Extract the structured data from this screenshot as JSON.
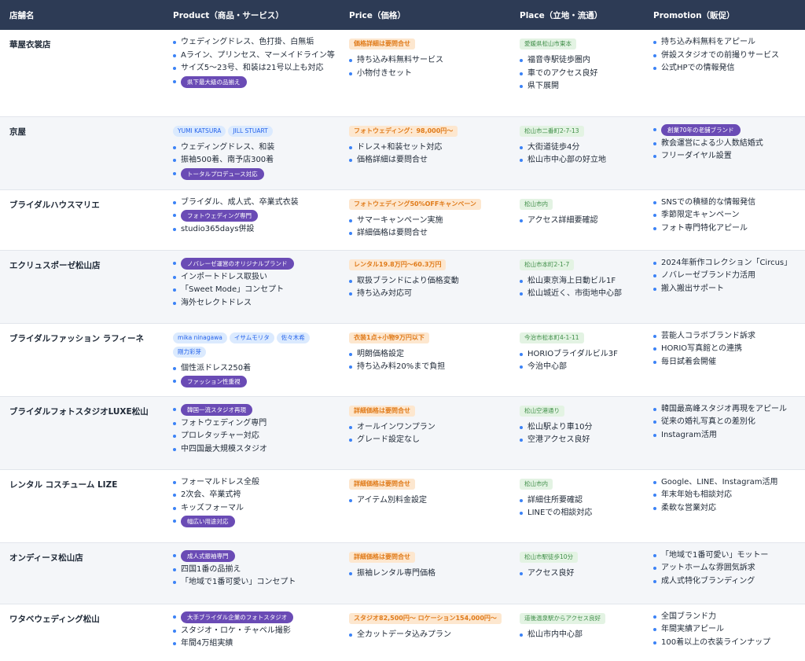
{
  "headers": [
    "店舗名",
    "Product（商品・サービス）",
    "Price（価格）",
    "Place（立地・流通）",
    "Promotion（販促）"
  ],
  "rows": [
    {
      "name": "華屋衣裳店",
      "product": {
        "tags": [],
        "items": [
          "ウェディングドレス、色打掛、白無垢",
          "Aライン、プリンセス、マーメイドライン等",
          "サイズ5〜23号、和装は21号以上も対応"
        ],
        "badge": "県下最大級の品揃え"
      },
      "price": {
        "tag": "価格詳細は要問合せ",
        "items": [
          "持ち込み料無料サービス",
          "小物付きセット"
        ]
      },
      "place": {
        "tag": "愛媛県松山市東本",
        "items": [
          "福音寺駅徒歩圏内",
          "車でのアクセス良好",
          "県下展開"
        ]
      },
      "promotion": {
        "badge": "",
        "items": [
          "持ち込み料無料をアピール",
          "併設スタジオでの前撮りサービス",
          "公式HPでの情報発信"
        ]
      }
    },
    {
      "name": "京屋",
      "product": {
        "tags": [
          "YUMI KATSURA",
          "JILL STUART"
        ],
        "items": [
          "ウェディングドレス、和装",
          "振袖500着、南予店300着"
        ],
        "badge": "トータルプロデュース対応"
      },
      "price": {
        "tag": "フォトウェディング：98,000円〜",
        "items": [
          "ドレス+和装セット対応",
          "価格詳細は要問合せ"
        ]
      },
      "place": {
        "tag": "松山市二番町2-7-13",
        "items": [
          "大街道徒歩4分",
          "松山市中心部の好立地"
        ]
      },
      "promotion": {
        "badge": "創業70年の老舗ブランド",
        "items": [
          "教会運営による少人数結婚式",
          "フリーダイヤル設置"
        ]
      }
    },
    {
      "name": "ブライダルハウスマリエ",
      "product": {
        "tags": [],
        "items": [
          "ブライダル、成人式、卒業式衣装"
        ],
        "badge": "フォトウェディング専門",
        "after": [
          "studio365days併設"
        ]
      },
      "price": {
        "tag": "フォトウェディング50%OFFキャンペーン",
        "items": [
          "サマーキャンペーン実施",
          "詳細価格は要問合せ"
        ]
      },
      "place": {
        "tag": "松山市内",
        "items": [
          "アクセス詳細要確認"
        ]
      },
      "promotion": {
        "badge": "",
        "items": [
          "SNSでの積極的な情報発信",
          "季節限定キャンペーン",
          "フォト専門特化アピール"
        ]
      }
    },
    {
      "name": "エクリュスポーゼ松山店",
      "product": {
        "tags": [],
        "items": [],
        "badge": "ノバレーゼ運営のオリジナルブランド",
        "after": [
          "インポートドレス取扱い",
          "「Sweet Mode」コンセプト",
          "海外セレクトドレス"
        ]
      },
      "price": {
        "tag": "レンタル19.8万円〜60.3万円",
        "items": [
          "取扱ブランドにより価格変動",
          "持ち込み対応可"
        ]
      },
      "place": {
        "tag": "松山市本町2-1-7",
        "items": [
          "松山東京海上日動ビル1F",
          "松山城近く、市街地中心部"
        ]
      },
      "promotion": {
        "badge": "",
        "items": [
          "2024年新作コレクション「Circus」",
          "ノバレーゼブランド力活用",
          "搬入搬出サポート"
        ]
      }
    },
    {
      "name": "ブライダルファッション ラフィーネ",
      "product": {
        "tags": [
          "mika ninagawa",
          "イサムモリタ",
          "佐々木希",
          "剛力彩芽"
        ],
        "items": [
          "個性派ドレス250着"
        ],
        "badge": "ファッション性重視"
      },
      "price": {
        "tag": "衣装1点+小物9万円以下",
        "items": [
          "明朗価格設定",
          "持ち込み料20%まで負担"
        ]
      },
      "place": {
        "tag": "今治市松本町4-1-11",
        "items": [
          "HORIOブライダルビル3F",
          "今治中心部"
        ]
      },
      "promotion": {
        "badge": "",
        "items": [
          "芸能人コラボブランド訴求",
          "HORIO写真館との連携",
          "毎日試着会開催"
        ]
      }
    },
    {
      "name": "ブライダルフォトスタジオLUXE松山",
      "product": {
        "tags": [],
        "items": [],
        "badge": "韓国一流スタジオ再現",
        "after": [
          "フォトウェディング専門",
          "プロレタッチャー対応",
          "中四国最大規模スタジオ"
        ]
      },
      "price": {
        "tag": "詳細価格は要問合せ",
        "items": [
          "オールインワンプラン",
          "グレード設定なし"
        ]
      },
      "place": {
        "tag": "松山空港通り",
        "items": [
          "松山駅より車10分",
          "空港アクセス良好"
        ]
      },
      "promotion": {
        "badge": "",
        "items": [
          "韓国最高峰スタジオ再現をアピール",
          "従来の婚礼写真との差別化",
          "Instagram活用"
        ]
      }
    },
    {
      "name": "レンタル コスチューム LIZE",
      "product": {
        "tags": [],
        "items": [
          "フォーマルドレス全般",
          "2次会、卒業式袴",
          "キッズフォーマル"
        ],
        "badge": "幅広い用途対応"
      },
      "price": {
        "tag": "詳細価格は要問合せ",
        "items": [
          "アイテム別料金設定"
        ]
      },
      "place": {
        "tag": "松山市内",
        "items": [
          "詳細住所要確認",
          "LINEでの相談対応"
        ]
      },
      "promotion": {
        "badge": "",
        "items": [
          "Google、LINE、Instagram活用",
          "年末年始も相談対応",
          "柔軟な営業対応"
        ]
      }
    },
    {
      "name": "オンディーヌ松山店",
      "product": {
        "tags": [],
        "items": [],
        "badge": "成人式振袖専門",
        "after": [
          "四国1番の品揃え",
          "「地域で1番可愛い」コンセプト"
        ]
      },
      "price": {
        "tag": "詳細価格は要問合せ",
        "items": [
          "振袖レンタル専門価格"
        ]
      },
      "place": {
        "tag": "松山市駅徒歩10分",
        "items": [
          "アクセス良好"
        ]
      },
      "promotion": {
        "badge": "",
        "items": [
          "「地域で1番可愛い」モットー",
          "アットホームな雰囲気訴求",
          "成人式特化ブランディング"
        ]
      }
    },
    {
      "name": "ワタベウェディング松山",
      "product": {
        "tags": [],
        "items": [],
        "badge": "大手ブライダル企業のフォトスタジオ",
        "after": [
          "スタジオ・ロケ・チャペル撮影",
          "年間4万組実績"
        ]
      },
      "price": {
        "tag": "スタジオ82,500円〜 ロケーション154,000円〜",
        "items": [
          "全カットデータ込みプラン"
        ]
      },
      "place": {
        "tag": "道後温泉駅からアクセス良好",
        "items": [
          "松山市内中心部"
        ]
      },
      "promotion": {
        "badge": "",
        "items": [
          "全国ブランド力",
          "年間実績アピール",
          "100着以上の衣装ラインナップ"
        ]
      }
    }
  ]
}
